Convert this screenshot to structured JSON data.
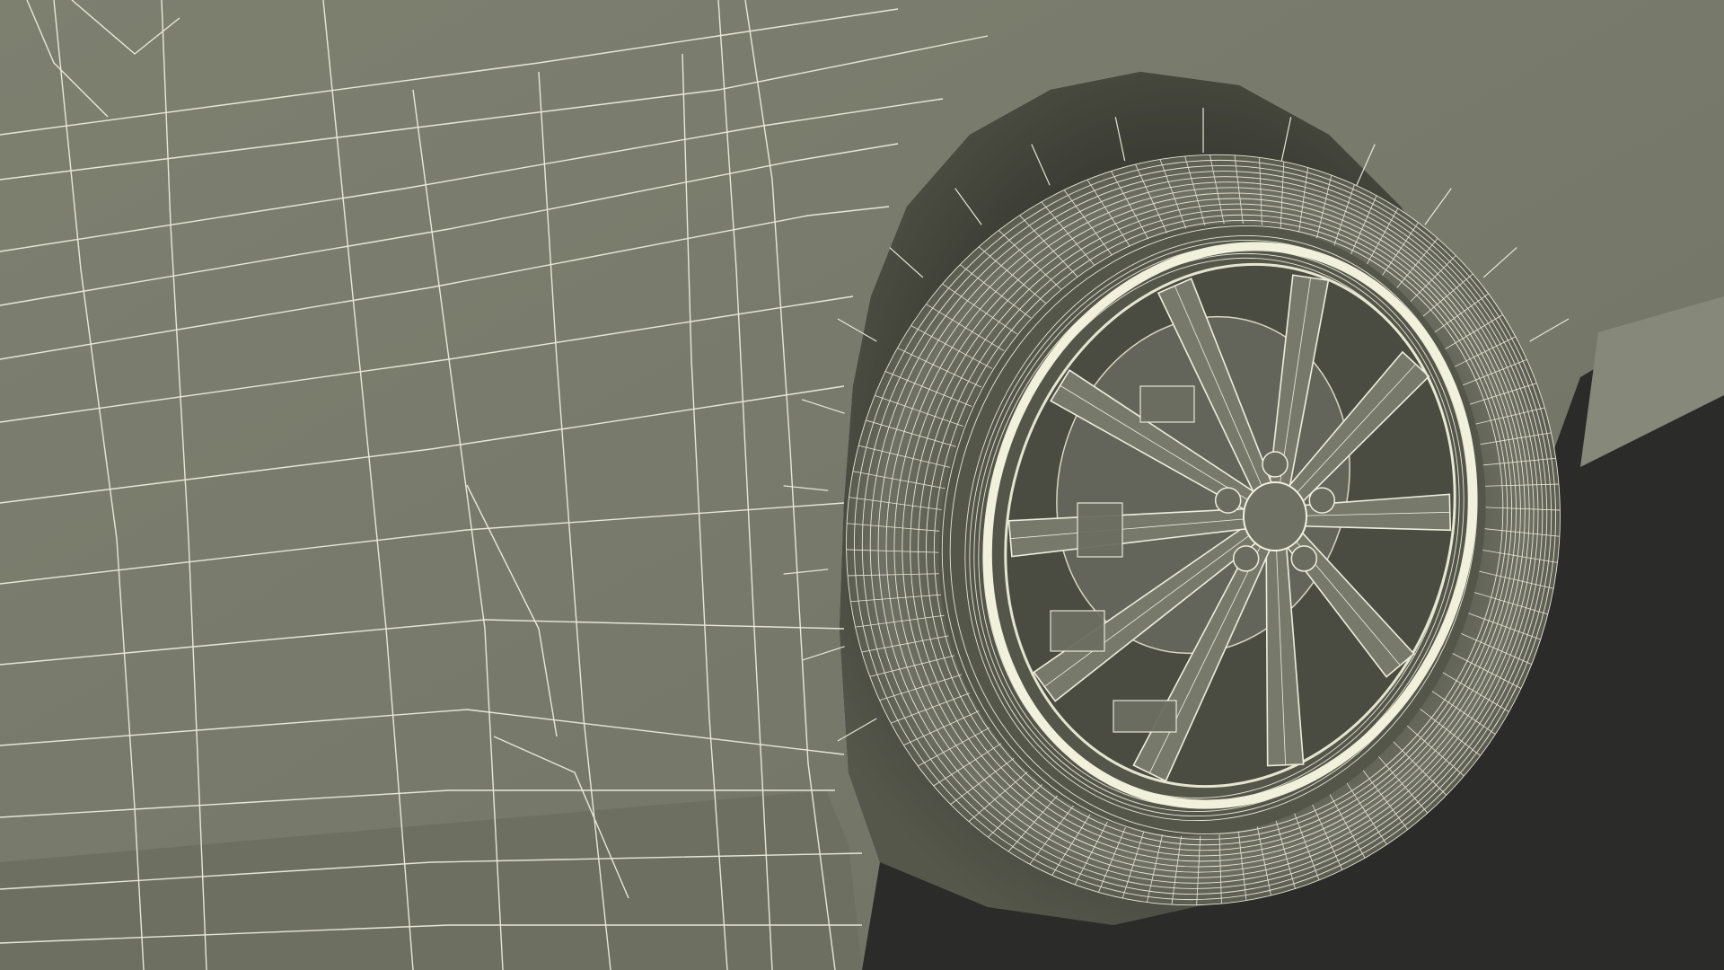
{
  "scene": {
    "subject": "wireframe-car-front-wheel-render",
    "colors": {
      "background": "#2b2b29",
      "body_panel": "#797b6b",
      "body_panel_dark": "#5f6253",
      "body_panel_light": "#868878",
      "wire": "#eeeedd",
      "rim_ring": "#f2f1dc",
      "tire_shadow": "#4f5145",
      "wheel_arch_shadow": "#3d3f36"
    },
    "wheel": {
      "spoke_count": 10,
      "lug_nut_count": 5
    }
  }
}
